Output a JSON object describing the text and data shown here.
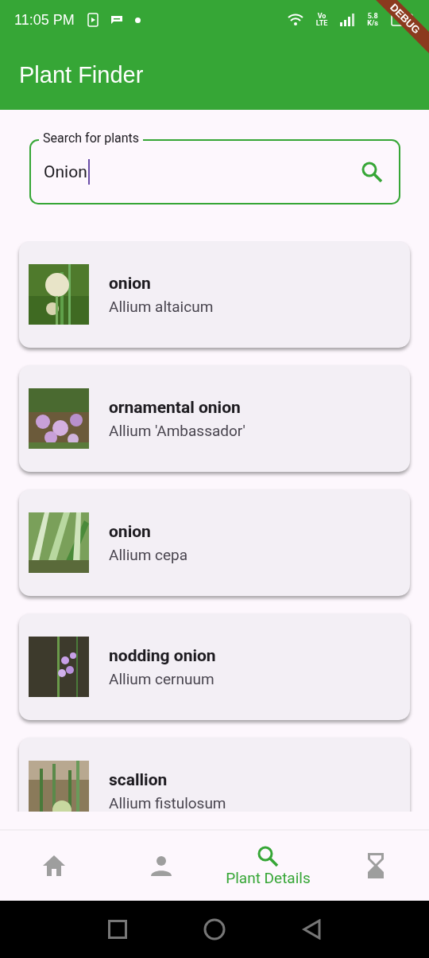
{
  "status_bar": {
    "time": "11:05 PM",
    "network": "Vo\nLTE",
    "speed": "5.8\nK/s"
  },
  "debug_banner": "DEBUG",
  "app_bar": {
    "title": "Plant Finder"
  },
  "search": {
    "label": "Search for plants",
    "value": "Onion"
  },
  "plants": [
    {
      "name": "onion",
      "scientific_name": "Allium altaicum"
    },
    {
      "name": "ornamental onion",
      "scientific_name": "Allium 'Ambassador'"
    },
    {
      "name": "onion",
      "scientific_name": "Allium cepa"
    },
    {
      "name": "nodding onion",
      "scientific_name": "Allium cernuum"
    },
    {
      "name": "scallion",
      "scientific_name": "Allium fistulosum"
    }
  ],
  "bottom_nav": [
    {
      "kind": "home",
      "selected": false
    },
    {
      "kind": "person",
      "selected": false
    },
    {
      "kind": "search",
      "label": "Plant Details",
      "selected": true
    },
    {
      "kind": "hourglass",
      "selected": false
    }
  ]
}
